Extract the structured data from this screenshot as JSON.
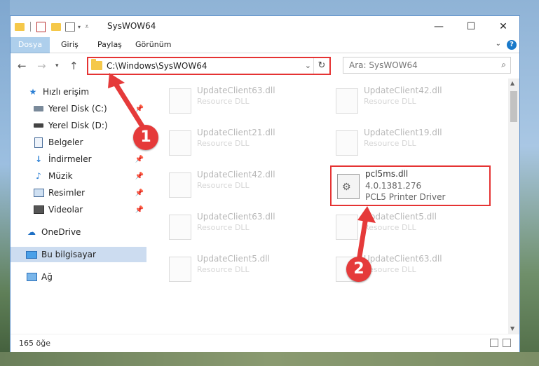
{
  "window": {
    "title": "SysWOW64"
  },
  "ribbon": {
    "tabs": [
      "Dosya",
      "Giriş",
      "Paylaş",
      "Görünüm"
    ],
    "help": "?"
  },
  "nav": {
    "address": "C:\\Windows\\SysWOW64",
    "search_placeholder": "Ara: SysWOW64"
  },
  "sidebar": {
    "items": [
      {
        "label": "Hızlı erişim",
        "icon": "star-icon"
      },
      {
        "label": "Yerel Disk (C:)",
        "icon": "drive-icon",
        "pinned": true
      },
      {
        "label": "Yerel Disk (D:)",
        "icon": "drive-icon"
      },
      {
        "label": "Belgeler",
        "icon": "document-icon",
        "pinned": true
      },
      {
        "label": "İndirmeler",
        "icon": "download-icon",
        "pinned": true
      },
      {
        "label": "Müzik",
        "icon": "music-icon",
        "pinned": true
      },
      {
        "label": "Resimler",
        "icon": "pictures-icon",
        "pinned": true
      },
      {
        "label": "Videolar",
        "icon": "video-icon",
        "pinned": true
      },
      {
        "label": "OneDrive",
        "icon": "cloud-icon"
      },
      {
        "label": "Bu bilgisayar",
        "icon": "computer-icon",
        "selected": true
      },
      {
        "label": "Ağ",
        "icon": "network-icon"
      }
    ]
  },
  "files": [
    {
      "name": "UpdateClient63.dll",
      "type": "Resource DLL"
    },
    {
      "name": "UpdateClient42.dll",
      "type": "Resource DLL"
    },
    {
      "name": "UpdateClient21.dll",
      "type": "Resource DLL"
    },
    {
      "name": "UpdateClient19.dll",
      "type": "Resource DLL"
    },
    {
      "name": "UpdateClient42.dll",
      "type": "Resource DLL"
    },
    {
      "name": "pcl5ms.dll",
      "version": "4.0.1381.276",
      "type": "PCL5 Printer Driver",
      "highlighted": true
    },
    {
      "name": "UpdateClient63.dll",
      "type": "Resource DLL"
    },
    {
      "name": "UpdateClient5.dll",
      "type": "Resource DLL"
    },
    {
      "name": "UpdateClient5.dll",
      "type": "Resource DLL"
    },
    {
      "name": "UpdateClient63.dll",
      "type": "Resource DLL"
    }
  ],
  "status": {
    "count": "165 öğe"
  },
  "annotations": {
    "step1": "1",
    "step2": "2"
  },
  "colors": {
    "highlight": "#e53333",
    "accent": "#1979ca"
  }
}
